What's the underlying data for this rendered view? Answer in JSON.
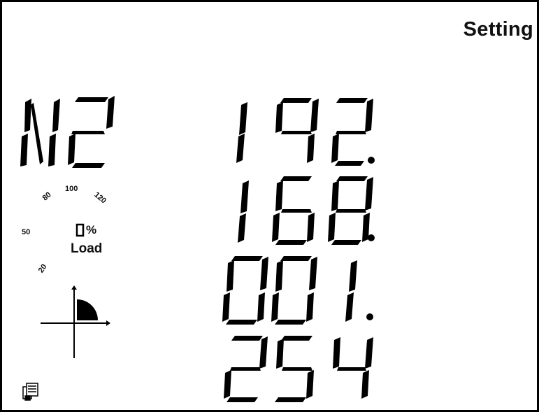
{
  "header": {
    "mode_label": "Setting"
  },
  "parameter_code": "N2",
  "ip_octets": [
    "192",
    "168",
    "001",
    "254"
  ],
  "load_gauge": {
    "ticks": [
      "20",
      "50",
      "80",
      "100",
      "120"
    ],
    "percent_symbol": "%",
    "label": "Load"
  },
  "icons": [
    "quadrant-icon",
    "communication-icon"
  ],
  "colors": {
    "segment": "#000000",
    "background": "#ffffff"
  }
}
